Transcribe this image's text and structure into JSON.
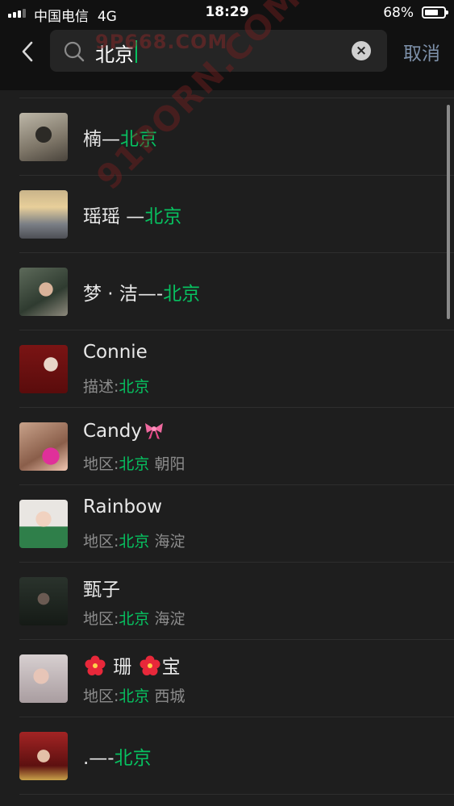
{
  "status": {
    "carrier": "中国电信",
    "network": "4G",
    "time": "18:29",
    "battery": "68%",
    "battery_level": 0.68
  },
  "search": {
    "query": "北京",
    "cancel_label": "取消"
  },
  "watermarks": [
    "9P668.COM",
    "91PORN.COM"
  ],
  "results": [
    {
      "prefix": "楠—",
      "match": "北京",
      "suffix": "",
      "desc_prefix": "",
      "desc_match": "",
      "desc_suffix": ""
    },
    {
      "prefix": "瑶瑶 —",
      "match": "北京",
      "suffix": "",
      "desc_prefix": "",
      "desc_match": "",
      "desc_suffix": ""
    },
    {
      "prefix": "梦 · 洁—-",
      "match": "北京",
      "suffix": "",
      "desc_prefix": "",
      "desc_match": "",
      "desc_suffix": ""
    },
    {
      "prefix": "Connie",
      "match": "",
      "suffix": "",
      "desc_prefix": "描述:",
      "desc_match": "北京",
      "desc_suffix": ""
    },
    {
      "prefix": "Candy",
      "match": "",
      "suffix": "",
      "desc_prefix": "地区:",
      "desc_match": "北京",
      "desc_suffix": " 朝阳"
    },
    {
      "prefix": "Rainbow",
      "match": "",
      "suffix": "",
      "desc_prefix": "地区:",
      "desc_match": "北京",
      "desc_suffix": " 海淀"
    },
    {
      "prefix": "甄子",
      "match": "",
      "suffix": "",
      "desc_prefix": "地区:",
      "desc_match": "北京",
      "desc_suffix": " 海淀"
    },
    {
      "prefix": "珊",
      "match": "",
      "suffix": "宝",
      "desc_prefix": "地区:",
      "desc_match": "北京",
      "desc_suffix": " 西城"
    },
    {
      "prefix": ".—-",
      "match": "北京",
      "suffix": "",
      "desc_prefix": "",
      "desc_match": "",
      "desc_suffix": ""
    }
  ],
  "colors": {
    "highlight": "#07c160",
    "background": "#1e1e1e",
    "header": "#111111",
    "cancel": "#7d90a9"
  },
  "icons": [
    "chevron-left-icon",
    "search-icon",
    "clear-icon",
    "ribbon-emoji-icon",
    "hibiscus-emoji-icon"
  ]
}
